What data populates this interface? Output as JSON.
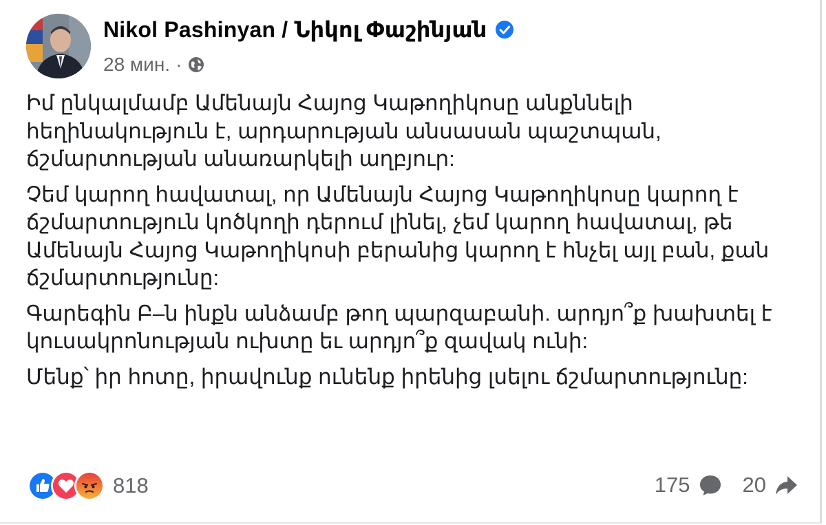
{
  "post": {
    "author": "Nikol Pashinyan / Նիկոլ Փաշինյան",
    "time": "28 мин.",
    "separator": "·",
    "paragraphs": [
      "Իմ ընկալմամբ Ամենայն Հայոց Կաթողիկոսը անքննելի հեղինակություն է, արդարության անսասան պաշտպան, ճշմարտության անառարկելի աղբյուր:",
      "Չեմ կարող հավատալ, որ Ամենայն Հայոց Կաթողիկոսը կարող է ճշմարտություն կոծկողի դերում լինել, չեմ կարող հավատալ, թե Ամենայն Հայոց Կաթողիկոսի բերանից կարող է հնչել այլ բան, քան ճշմարտությունը:",
      "Գարեգին Բ–ն ինքն անձամբ թող պարզաբանի. արդյո՞ք խախտել է կուսակրոնության ուխտը եւ արդյո՞ք զավակ ունի:",
      "Մենք՝ իր հոտը, իրավունք ունենք իրենից լսելու ճշմարտությունը:"
    ]
  },
  "reactions": {
    "count": "818",
    "icons": [
      "like-icon",
      "love-icon",
      "angry-icon"
    ]
  },
  "stats": {
    "comments": "175",
    "shares": "20"
  },
  "colors": {
    "verified": "#1877f2",
    "like": "#1877f2",
    "love": "#f33e58",
    "angry": "#f7714a",
    "secondary_text": "#65676b"
  }
}
